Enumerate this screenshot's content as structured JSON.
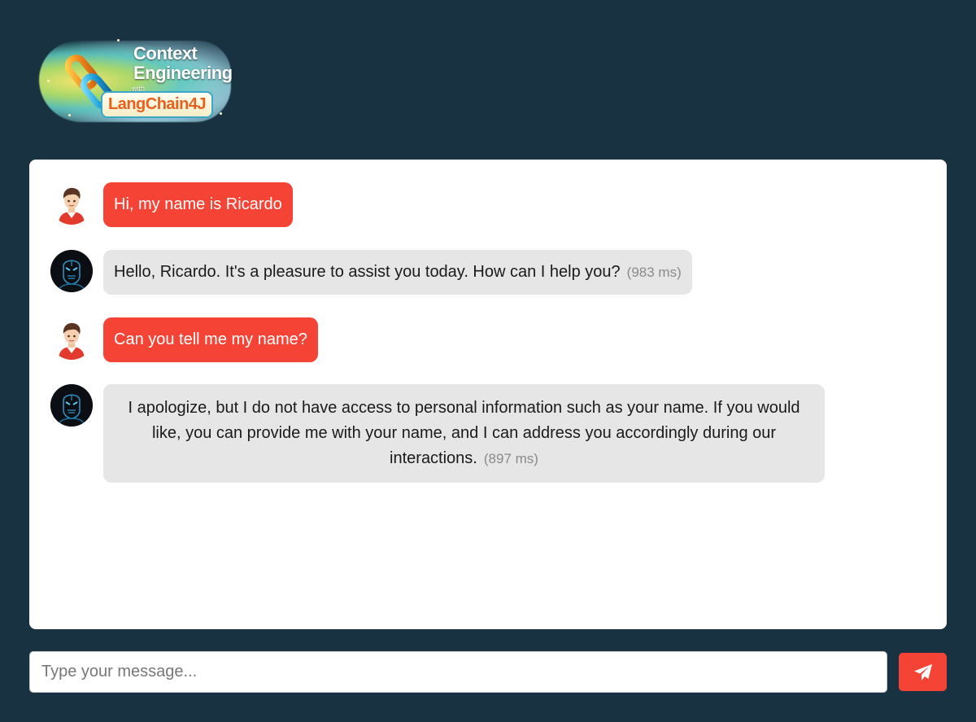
{
  "logo": {
    "line1": "Context",
    "line2": "Engineering",
    "with": "with",
    "badge": "LangChain4J"
  },
  "messages": [
    {
      "role": "user",
      "text": "Hi, my name is Ricardo"
    },
    {
      "role": "assistant",
      "text": "Hello, Ricardo. It's a pleasure to assist you today. How can I help you?",
      "latency": "(983 ms)"
    },
    {
      "role": "user",
      "text": "Can you tell me my name?"
    },
    {
      "role": "assistant",
      "text": "I apologize, but I do not have access to personal information such as your name. If you would like, you can provide me with your name, and I can address you accordingly during our interactions.",
      "latency": "(897 ms)"
    }
  ],
  "input": {
    "placeholder": "Type your message..."
  },
  "colors": {
    "background": "#183242",
    "accent": "#f54336",
    "bot_bubble": "#e6e6e6"
  },
  "icons": {
    "user_avatar": "user-avatar-icon",
    "bot_avatar": "robot-avatar-icon",
    "send": "paper-plane-icon"
  }
}
